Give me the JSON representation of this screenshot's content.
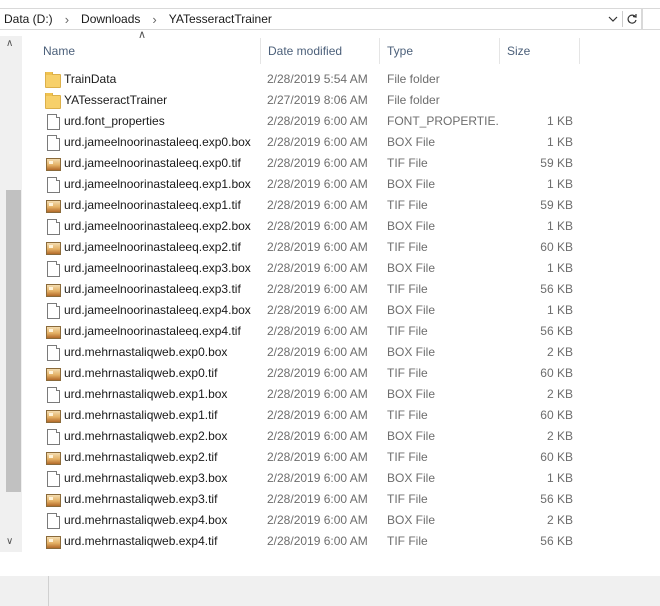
{
  "address": {
    "crumbs": [
      "Data (D:)",
      "Downloads",
      "YATesseractTrainer"
    ],
    "dropdown_icon": "chevron-down-icon",
    "refresh_icon": "refresh-icon"
  },
  "columns": {
    "name": "Name",
    "date": "Date modified",
    "type": "Type",
    "size": "Size"
  },
  "files": [
    {
      "name": "TrainData",
      "date": "2/28/2019 5:54 AM",
      "type": "File folder",
      "size": "",
      "icon": "folder-icon"
    },
    {
      "name": "YATesseractTrainer",
      "date": "2/27/2019 8:06 AM",
      "type": "File folder",
      "size": "",
      "icon": "folder-icon"
    },
    {
      "name": "urd.font_properties",
      "date": "2/28/2019 6:00 AM",
      "type": "FONT_PROPERTIE...",
      "size": "1 KB",
      "icon": "document-icon"
    },
    {
      "name": "urd.jameelnoorinastaleeq.exp0.box",
      "date": "2/28/2019 6:00 AM",
      "type": "BOX File",
      "size": "1 KB",
      "icon": "document-icon"
    },
    {
      "name": "urd.jameelnoorinastaleeq.exp0.tif",
      "date": "2/28/2019 6:00 AM",
      "type": "TIF File",
      "size": "59 KB",
      "icon": "image-icon"
    },
    {
      "name": "urd.jameelnoorinastaleeq.exp1.box",
      "date": "2/28/2019 6:00 AM",
      "type": "BOX File",
      "size": "1 KB",
      "icon": "document-icon"
    },
    {
      "name": "urd.jameelnoorinastaleeq.exp1.tif",
      "date": "2/28/2019 6:00 AM",
      "type": "TIF File",
      "size": "59 KB",
      "icon": "image-icon"
    },
    {
      "name": "urd.jameelnoorinastaleeq.exp2.box",
      "date": "2/28/2019 6:00 AM",
      "type": "BOX File",
      "size": "1 KB",
      "icon": "document-icon"
    },
    {
      "name": "urd.jameelnoorinastaleeq.exp2.tif",
      "date": "2/28/2019 6:00 AM",
      "type": "TIF File",
      "size": "60 KB",
      "icon": "image-icon"
    },
    {
      "name": "urd.jameelnoorinastaleeq.exp3.box",
      "date": "2/28/2019 6:00 AM",
      "type": "BOX File",
      "size": "1 KB",
      "icon": "document-icon"
    },
    {
      "name": "urd.jameelnoorinastaleeq.exp3.tif",
      "date": "2/28/2019 6:00 AM",
      "type": "TIF File",
      "size": "56 KB",
      "icon": "image-icon"
    },
    {
      "name": "urd.jameelnoorinastaleeq.exp4.box",
      "date": "2/28/2019 6:00 AM",
      "type": "BOX File",
      "size": "1 KB",
      "icon": "document-icon"
    },
    {
      "name": "urd.jameelnoorinastaleeq.exp4.tif",
      "date": "2/28/2019 6:00 AM",
      "type": "TIF File",
      "size": "56 KB",
      "icon": "image-icon"
    },
    {
      "name": "urd.mehrnastaliqweb.exp0.box",
      "date": "2/28/2019 6:00 AM",
      "type": "BOX File",
      "size": "2 KB",
      "icon": "document-icon"
    },
    {
      "name": "urd.mehrnastaliqweb.exp0.tif",
      "date": "2/28/2019 6:00 AM",
      "type": "TIF File",
      "size": "60 KB",
      "icon": "image-icon"
    },
    {
      "name": "urd.mehrnastaliqweb.exp1.box",
      "date": "2/28/2019 6:00 AM",
      "type": "BOX File",
      "size": "2 KB",
      "icon": "document-icon"
    },
    {
      "name": "urd.mehrnastaliqweb.exp1.tif",
      "date": "2/28/2019 6:00 AM",
      "type": "TIF File",
      "size": "60 KB",
      "icon": "image-icon"
    },
    {
      "name": "urd.mehrnastaliqweb.exp2.box",
      "date": "2/28/2019 6:00 AM",
      "type": "BOX File",
      "size": "2 KB",
      "icon": "document-icon"
    },
    {
      "name": "urd.mehrnastaliqweb.exp2.tif",
      "date": "2/28/2019 6:00 AM",
      "type": "TIF File",
      "size": "60 KB",
      "icon": "image-icon"
    },
    {
      "name": "urd.mehrnastaliqweb.exp3.box",
      "date": "2/28/2019 6:00 AM",
      "type": "BOX File",
      "size": "1 KB",
      "icon": "document-icon"
    },
    {
      "name": "urd.mehrnastaliqweb.exp3.tif",
      "date": "2/28/2019 6:00 AM",
      "type": "TIF File",
      "size": "56 KB",
      "icon": "image-icon"
    },
    {
      "name": "urd.mehrnastaliqweb.exp4.box",
      "date": "2/28/2019 6:00 AM",
      "type": "BOX File",
      "size": "2 KB",
      "icon": "document-icon"
    },
    {
      "name": "urd.mehrnastaliqweb.exp4.tif",
      "date": "2/28/2019 6:00 AM",
      "type": "TIF File",
      "size": "56 KB",
      "icon": "image-icon"
    }
  ]
}
